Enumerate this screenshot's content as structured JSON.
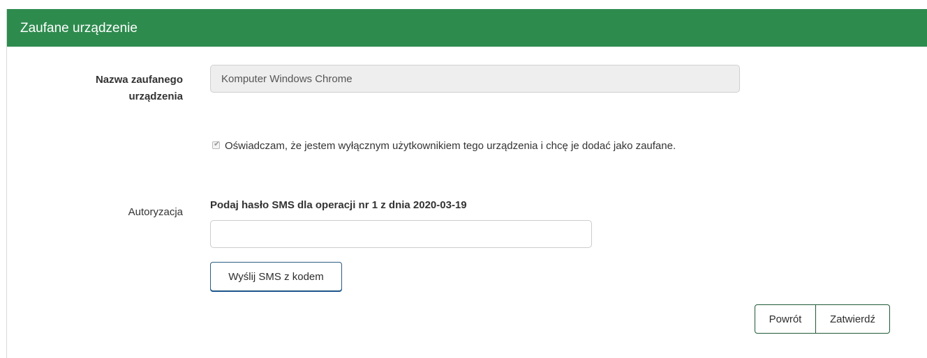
{
  "header": {
    "title": "Zaufane urządzenie"
  },
  "device": {
    "label": "Nazwa zaufanego urządzenia",
    "value": "Komputer Windows Chrome"
  },
  "consent": {
    "checked": true,
    "text": "Oświadczam, że jestem wyłącznym użytkownikiem tego urządzenia i chcę je dodać jako zaufane."
  },
  "authorization": {
    "label": "Autoryzacja",
    "sms_prompt": "Podaj hasło SMS dla operacji nr 1 z dnia 2020-03-19",
    "sms_value": "",
    "send_sms_label": "Wyślij SMS z kodem"
  },
  "actions": {
    "back_label": "Powrót",
    "submit_label": "Zatwierdź"
  },
  "colors": {
    "header_bg": "#2e8b4e",
    "button_border": "#1f5a35"
  }
}
